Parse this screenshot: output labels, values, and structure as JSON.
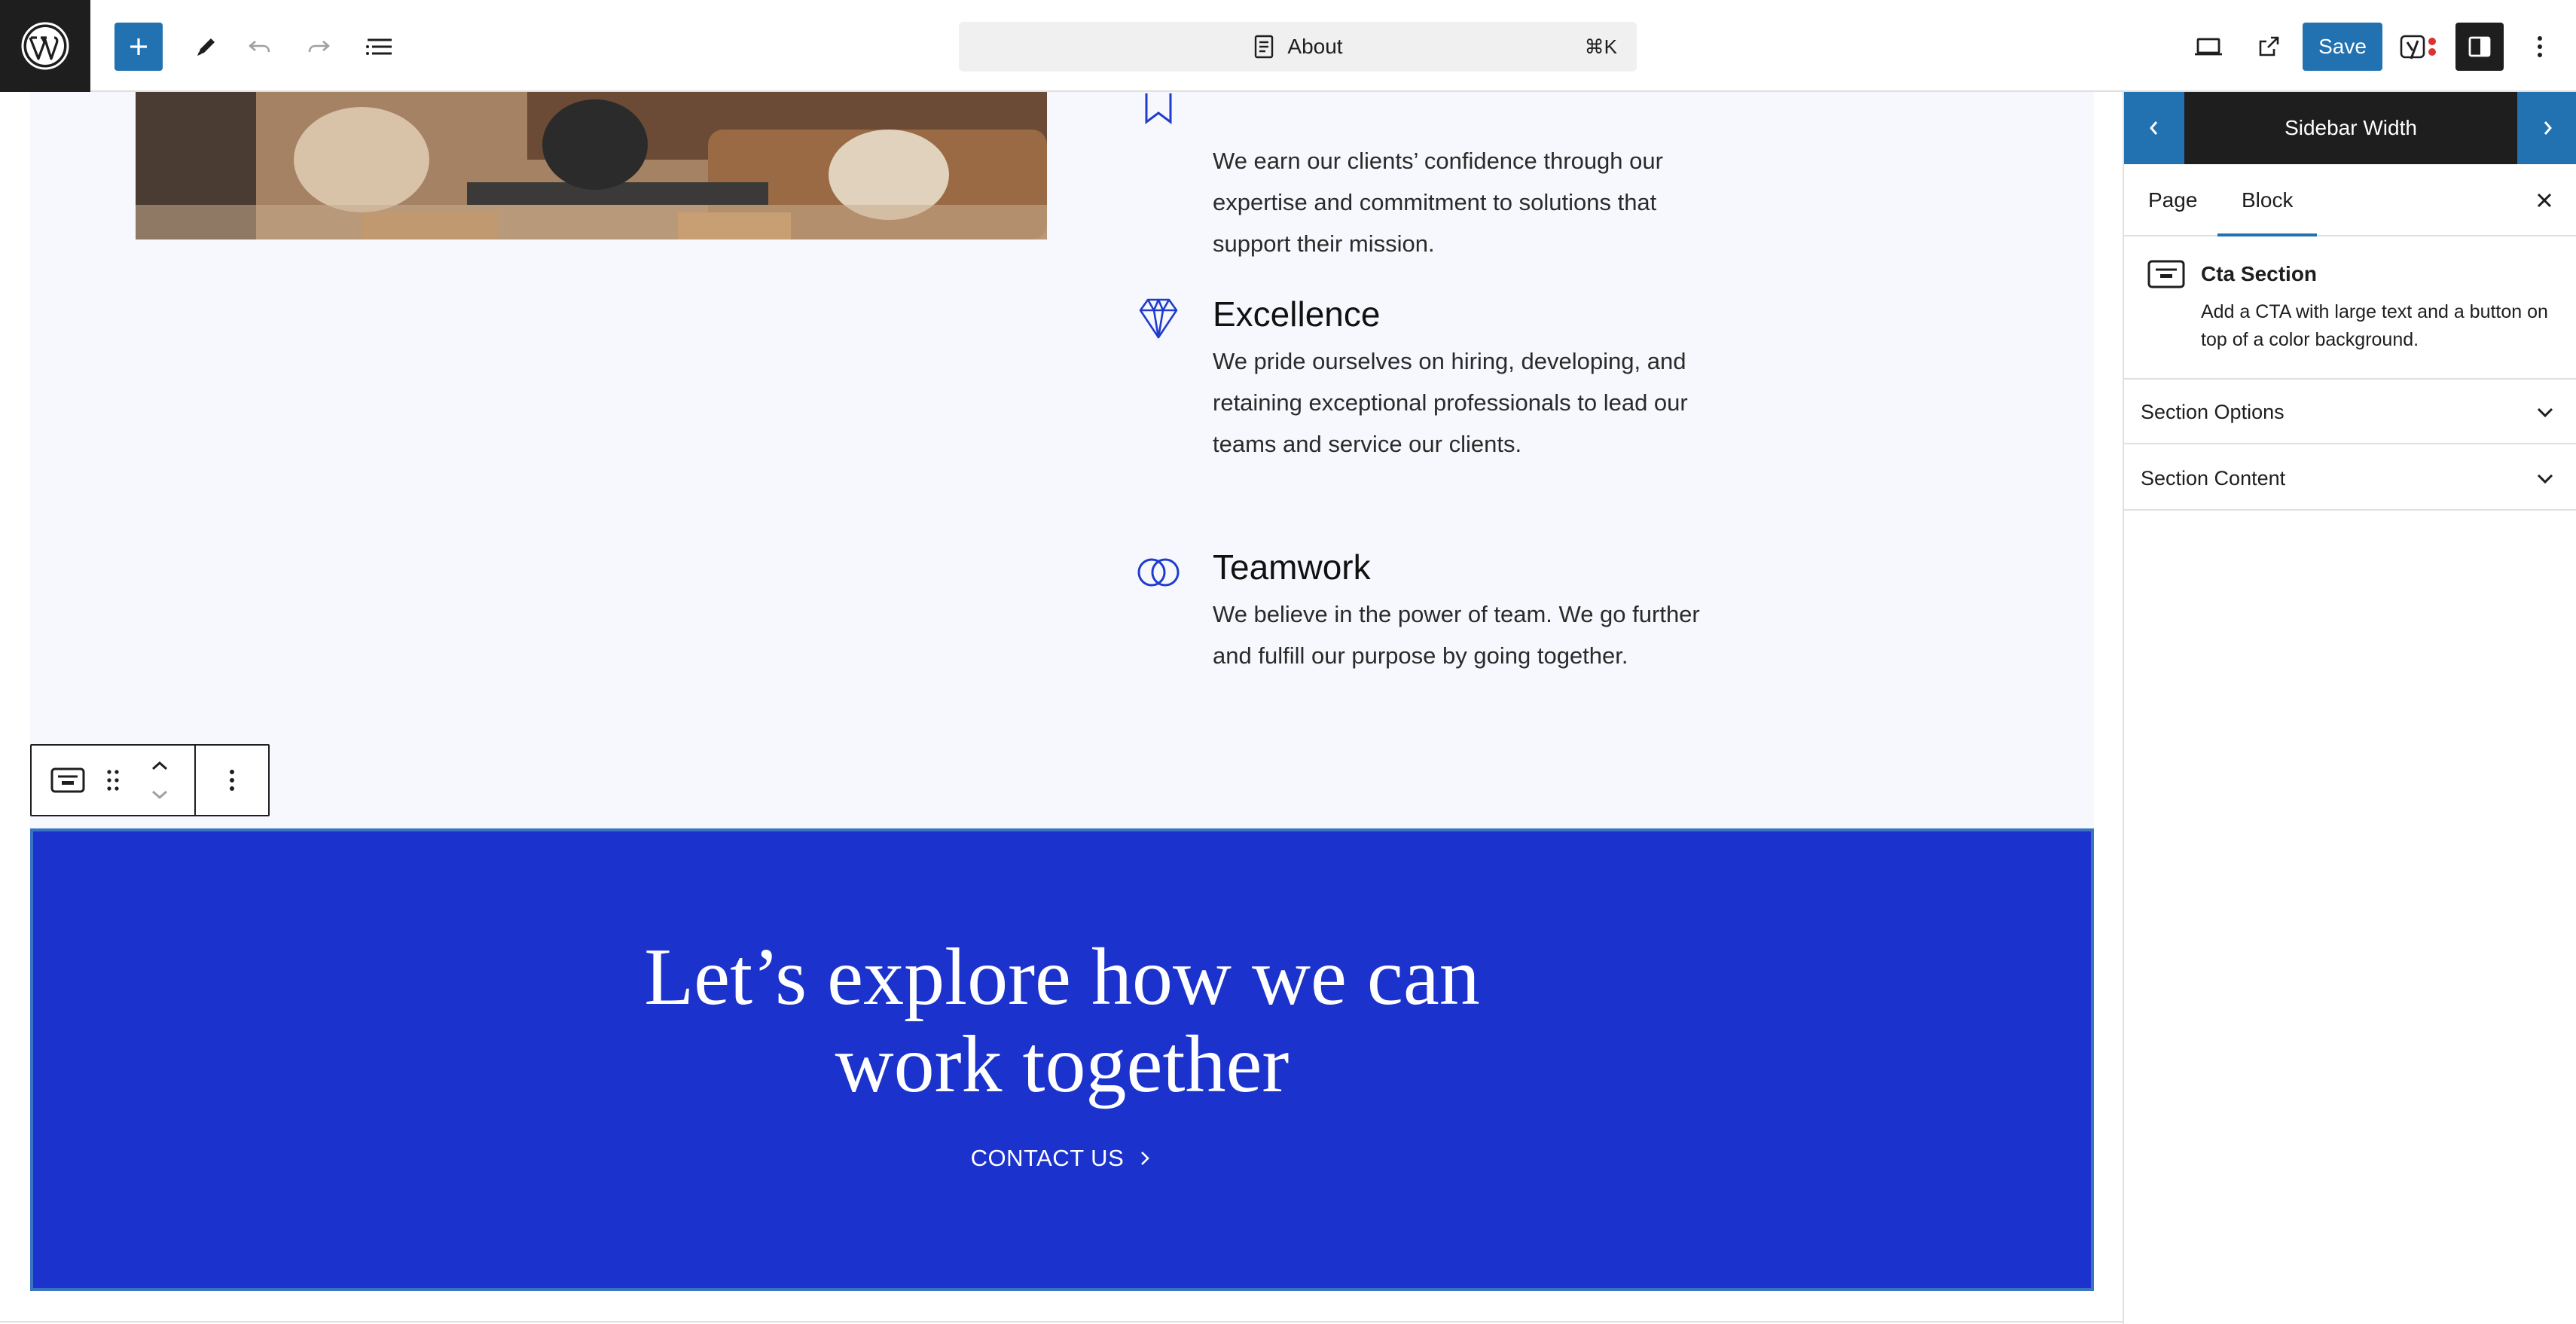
{
  "toolbar": {
    "document_title": "About",
    "shortcut": "⌘K",
    "save_label": "Save"
  },
  "canvas": {
    "values": [
      {
        "title": "",
        "text": "We earn our clients’ confidence through our expertise and commitment to solutions that support their mission."
      },
      {
        "title": "Excellence",
        "text": "We pride ourselves on hiring, developing, and retaining exceptional professionals to lead our teams and service our clients."
      },
      {
        "title": "Teamwork",
        "text": "We believe in the power of team. We go further and fulfill our purpose by going together."
      }
    ],
    "cta": {
      "heading_line1": "Let’s explore how we can",
      "heading_line2": "work together",
      "link": "CONTACT US",
      "background": "#1b33cc"
    }
  },
  "sidebar": {
    "width_bar_title": "Sidebar Width",
    "tabs": {
      "page": "Page",
      "block": "Block"
    },
    "block": {
      "name": "Cta Section",
      "description": "Add a CTA with large text and a button on top of a color background."
    },
    "panels": {
      "options": "Section Options",
      "content": "Section Content"
    }
  },
  "colors": {
    "accent": "#2271b1",
    "icon_blue": "#1f3ccc",
    "dark": "#1e1e1e"
  }
}
